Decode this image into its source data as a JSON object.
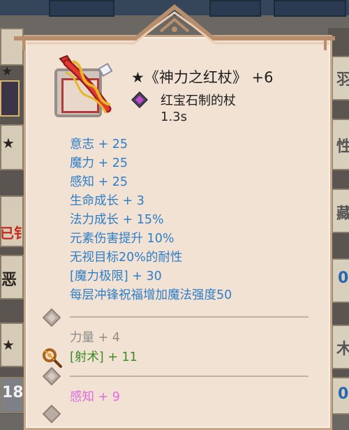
{
  "item": {
    "star": "★",
    "name": "《神力之红杖》",
    "level": "+6",
    "material": "红宝石制的杖",
    "speed": "1.3s"
  },
  "stats": [
    "意志 + 25",
    "魔力 + 25",
    "感知 + 25",
    "生命成长 + 3",
    "法力成长 + 15%",
    "元素伤害提升 10%",
    "无视目标20%的耐性",
    "[魔力极限] + 30",
    "每层冲锋祝福增加魔法强度50"
  ],
  "socket1": {
    "text": "力量 + 4"
  },
  "socket2": {
    "text": "[射术] + 11"
  },
  "socket3": {
    "text": "感知 + 9"
  },
  "side": {
    "left": [
      "★",
      "★",
      "已钅",
      "恶",
      "★",
      "18"
    ],
    "right": [
      "羽",
      "性",
      "藏",
      "0",
      "木",
      "0"
    ]
  },
  "colors": {
    "stat_blue": "#2e7ec8",
    "gray": "#8f8c88",
    "green": "#3e8c28",
    "pink": "#e26adf",
    "panel": "#f1e2d3"
  }
}
